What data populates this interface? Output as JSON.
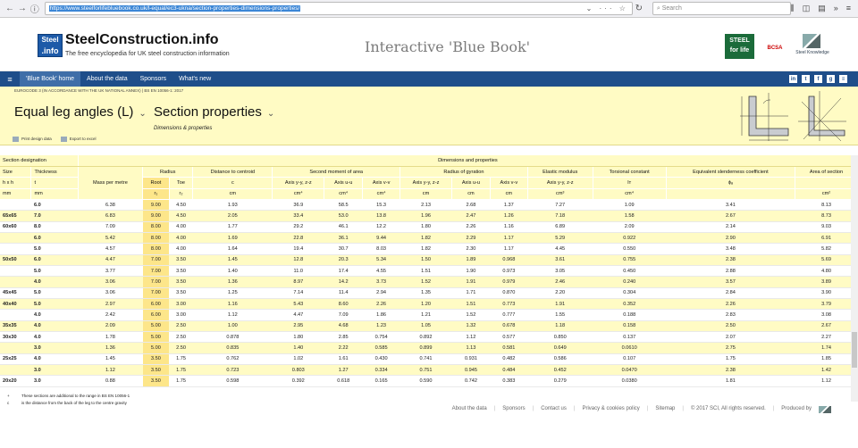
{
  "browser": {
    "url": "https://www.steelforlifebluebook.co.uk/l-equal/ec3-ukna/section-properties-dimensions-properties/",
    "url_tail": "⌄ ··· ☆",
    "search_placeholder": "Search"
  },
  "header": {
    "logo_top": "Steel",
    "logo_bottom": ".info",
    "site_name": "SteelConstruction.info",
    "tagline": "The free encyclopedia for UK steel construction information",
    "bluebook_title": "Interactive 'Blue Book'",
    "partner1": "STEEL for life",
    "partner2": "BCSA",
    "partner3": "Steel Knowledge"
  },
  "nav": {
    "menu_icon": "≡",
    "items": [
      "'Blue Book' home",
      "About the data",
      "Sponsors",
      "What's new"
    ],
    "social": [
      "in",
      "t",
      "f",
      "g",
      "≡"
    ]
  },
  "panel": {
    "standard": "EUROCODE 3 (IN ACCORDANCE WITH THE UK NATIONAL ANNEX) | BS EN 10056-1: 2017",
    "section_type": "Equal leg angles (L)",
    "page_type": "Section properties",
    "subtitle": "Dimensions & properties",
    "print_label": "Print design data",
    "export_label": "Export to excel"
  },
  "table": {
    "group_header": "Dimensions and properties",
    "section_designation": "Section designation",
    "size": "Size",
    "size_sym": "h x h",
    "size_unit": "mm",
    "thickness": "Thickness",
    "thickness_sym": "t",
    "thickness_unit": "mm",
    "mass": "Mass per metre",
    "mass_unit": "kg/m",
    "radius": "Radius",
    "root": "Root",
    "root_sym": "r₁",
    "root_unit": "mm",
    "toe": "Toe",
    "toe_sym": "r₂",
    "toe_unit": "mm",
    "centroid": "Distance to centroid",
    "centroid_sym": "c",
    "centroid_unit": "cm",
    "second_moment": "Second moment of area",
    "gyration": "Radius of gyration",
    "elastic": "Elastic modulus",
    "axis_yy_zz": "Axis y-y, z-z",
    "axis_uu": "Axis u-u",
    "axis_vv": "Axis v-v",
    "cm4": "cm⁴",
    "cm": "cm",
    "cm3": "cm³",
    "torsional": "Torsional constant",
    "torsional_sym": "Iᴛ",
    "torsional_unit": "cm⁴",
    "slenderness": "Equivalent slenderness coefficient",
    "slenderness_sym": "ϕₐ",
    "area": "Area of section",
    "area_unit": "cm²",
    "rows": [
      [
        "",
        "6.0",
        "6.38",
        "9.00",
        "4.50",
        "1.93",
        "36.9",
        "58.5",
        "15.3",
        "2.13",
        "2.68",
        "1.37",
        "7.27",
        "1.09",
        "3.41",
        "8.13"
      ],
      [
        "65x65",
        "7.0",
        "6.83",
        "9.00",
        "4.50",
        "2.05",
        "33.4",
        "53.0",
        "13.8",
        "1.96",
        "2.47",
        "1.26",
        "7.18",
        "1.58",
        "2.67",
        "8.73"
      ],
      [
        "60x60",
        "8.0",
        "7.09",
        "8.00",
        "4.00",
        "1.77",
        "29.2",
        "46.1",
        "12.2",
        "1.80",
        "2.26",
        "1.16",
        "6.89",
        "2.09",
        "2.14",
        "9.03"
      ],
      [
        "",
        "6.0",
        "5.42",
        "8.00",
        "4.00",
        "1.69",
        "22.8",
        "36.1",
        "9.44",
        "1.82",
        "2.29",
        "1.17",
        "5.29",
        "0.922",
        "2.90",
        "6.91"
      ],
      [
        "",
        "5.0",
        "4.57",
        "8.00",
        "4.00",
        "1.64",
        "19.4",
        "30.7",
        "8.03",
        "1.82",
        "2.30",
        "1.17",
        "4.45",
        "0.550",
        "3.48",
        "5.82"
      ],
      [
        "50x50",
        "6.0",
        "4.47",
        "7.00",
        "3.50",
        "1.45",
        "12.8",
        "20.3",
        "5.34",
        "1.50",
        "1.89",
        "0.968",
        "3.61",
        "0.755",
        "2.38",
        "5.69"
      ],
      [
        "",
        "5.0",
        "3.77",
        "7.00",
        "3.50",
        "1.40",
        "11.0",
        "17.4",
        "4.55",
        "1.51",
        "1.90",
        "0.973",
        "3.05",
        "0.450",
        "2.88",
        "4.80"
      ],
      [
        "",
        "4.0",
        "3.06",
        "7.00",
        "3.50",
        "1.36",
        "8.97",
        "14.2",
        "3.73",
        "1.52",
        "1.91",
        "0.979",
        "2.46",
        "0.240",
        "3.57",
        "3.89"
      ],
      [
        "45x45",
        "5.0",
        "3.06",
        "7.00",
        "3.50",
        "1.25",
        "7.14",
        "11.4",
        "2.94",
        "1.35",
        "1.71",
        "0.870",
        "2.20",
        "0.304",
        "2.84",
        "3.90"
      ],
      [
        "40x40",
        "5.0",
        "2.97",
        "6.00",
        "3.00",
        "1.16",
        "5.43",
        "8.60",
        "2.26",
        "1.20",
        "1.51",
        "0.773",
        "1.91",
        "0.352",
        "2.26",
        "3.79"
      ],
      [
        "",
        "4.0",
        "2.42",
        "6.00",
        "3.00",
        "1.12",
        "4.47",
        "7.09",
        "1.86",
        "1.21",
        "1.52",
        "0.777",
        "1.55",
        "0.188",
        "2.83",
        "3.08"
      ],
      [
        "35x35",
        "4.0",
        "2.09",
        "5.00",
        "2.50",
        "1.00",
        "2.95",
        "4.68",
        "1.23",
        "1.05",
        "1.32",
        "0.678",
        "1.18",
        "0.158",
        "2.50",
        "2.67"
      ],
      [
        "30x30",
        "4.0",
        "1.78",
        "5.00",
        "2.50",
        "0.878",
        "1.80",
        "2.85",
        "0.754",
        "0.892",
        "1.12",
        "0.577",
        "0.850",
        "0.137",
        "2.07",
        "2.27"
      ],
      [
        "",
        "3.0",
        "1.36",
        "5.00",
        "2.50",
        "0.835",
        "1.40",
        "2.22",
        "0.585",
        "0.899",
        "1.13",
        "0.581",
        "0.649",
        "0.0610",
        "2.75",
        "1.74"
      ],
      [
        "25x25",
        "4.0",
        "1.45",
        "3.50",
        "1.75",
        "0.762",
        "1.02",
        "1.61",
        "0.430",
        "0.741",
        "0.931",
        "0.482",
        "0.586",
        "0.107",
        "1.75",
        "1.85"
      ],
      [
        "",
        "3.0",
        "1.12",
        "3.50",
        "1.75",
        "0.723",
        "0.803",
        "1.27",
        "0.334",
        "0.751",
        "0.945",
        "0.484",
        "0.452",
        "0.0470",
        "2.38",
        "1.42"
      ],
      [
        "20x20",
        "3.0",
        "0.88",
        "3.50",
        "1.75",
        "0.598",
        "0.392",
        "0.618",
        "0.165",
        "0.590",
        "0.742",
        "0.383",
        "0.279",
        "0.0380",
        "1.81",
        "1.12"
      ]
    ]
  },
  "footnotes": [
    {
      "mark": "+",
      "text": "These sections are additional to the range in BS EN 10056-1"
    },
    {
      "mark": "c",
      "text": "is the distance from the back of the leg to the centre gravity"
    }
  ],
  "footer_links": [
    "About the data",
    "Sponsors",
    "Contact us",
    "Privacy & cookies policy",
    "Sitemap",
    "© 2017 SCI, All rights reserved.",
    "Produced by"
  ]
}
